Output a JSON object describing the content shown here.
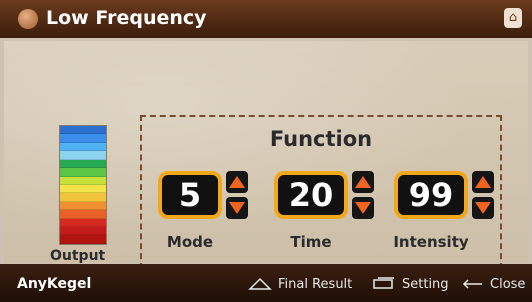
{
  "titlebar": {
    "title": "Low Frequency"
  },
  "output": {
    "label": "Output",
    "colors": [
      "#2b6fcf",
      "#3a8de8",
      "#4fb2f3",
      "#8cd3ee",
      "#27a852",
      "#5bc744",
      "#c6e03c",
      "#f4e34a",
      "#f0c43d",
      "#ef8f2f",
      "#e85f28",
      "#d42a20",
      "#c41c18",
      "#b3130f"
    ]
  },
  "function": {
    "title": "Function",
    "controls": [
      {
        "label": "Mode",
        "value": "5"
      },
      {
        "label": "Time",
        "value": "20"
      },
      {
        "label": "Intensity",
        "value": "99"
      }
    ]
  },
  "footer": {
    "brand": "AnyKegel",
    "final_result": "Final Result",
    "setting": "Setting",
    "close": "Close"
  },
  "colors": {
    "accent": "#f3a81a",
    "arrow": "#f06422",
    "bar": "#3b1d0b"
  }
}
